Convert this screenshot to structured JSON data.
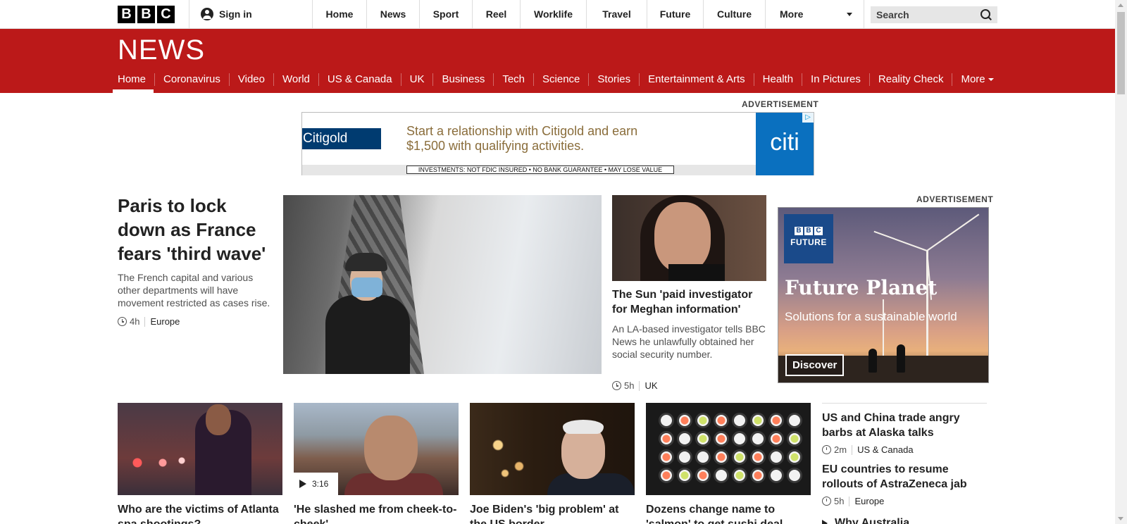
{
  "global_header": {
    "logo_letters": [
      "B",
      "B",
      "C"
    ],
    "sign_in": "Sign in",
    "nav": [
      "Home",
      "News",
      "Sport",
      "Reel",
      "Worklife",
      "Travel",
      "Future",
      "Culture"
    ],
    "more": "More",
    "search_placeholder": "Search"
  },
  "news_header": {
    "title": "NEWS",
    "nav": [
      "Home",
      "Coronavirus",
      "Video",
      "World",
      "US & Canada",
      "UK",
      "Business",
      "Tech",
      "Science",
      "Stories",
      "Entertainment & Arts",
      "Health",
      "In Pictures",
      "Reality Check"
    ],
    "more": "More",
    "active": "Home",
    "colors": {
      "brand_red": "#bb1919"
    }
  },
  "ad_top": {
    "label": "ADVERTISEMENT",
    "brand": "Citigold",
    "copy_line1": "Start a relationship with Citigold and earn",
    "copy_line2": "$1,500 with qualifying activities.",
    "disclaimer": "INVESTMENTS: NOT FDIC INSURED • NO BANK GUARANTEE • MAY LOSE VALUE",
    "logo": "citi"
  },
  "lead_story": {
    "headline": "Paris to lock down as France fears 'third wave'",
    "summary": "The French capital and various other departments will have movement restricted as cases rise.",
    "time": "4h",
    "tag": "Europe"
  },
  "second_story": {
    "headline": "The Sun 'paid investigator for Meghan information'",
    "summary": "An LA-based investigator tells BBC News he unlawfully obtained her social security number.",
    "time": "5h",
    "tag": "UK"
  },
  "ad_side": {
    "label": "ADVERTISEMENT",
    "badge_letters": [
      "B",
      "B",
      "C"
    ],
    "badge_word": "FUTURE",
    "title": "Future Planet",
    "subtitle": "Solutions for a sustainable world",
    "cta": "Discover"
  },
  "cards": [
    {
      "title": "Who are the victims of Atlanta spa shootings?"
    },
    {
      "title": "'He slashed me from cheek-to-cheek'",
      "video_duration": "3:16"
    },
    {
      "title": "Joe Biden's 'big problem' at the US border"
    },
    {
      "title": "Dozens change name to 'salmon' to get sushi deal"
    }
  ],
  "side_list": [
    {
      "title": "US and China trade angry barbs at Alaska talks",
      "time": "2m",
      "tag": "US & Canada"
    },
    {
      "title": "EU countries to resume rollouts of AstraZeneca jab",
      "time": "5h",
      "tag": "Europe"
    }
  ],
  "side_partial": "Why Australia"
}
